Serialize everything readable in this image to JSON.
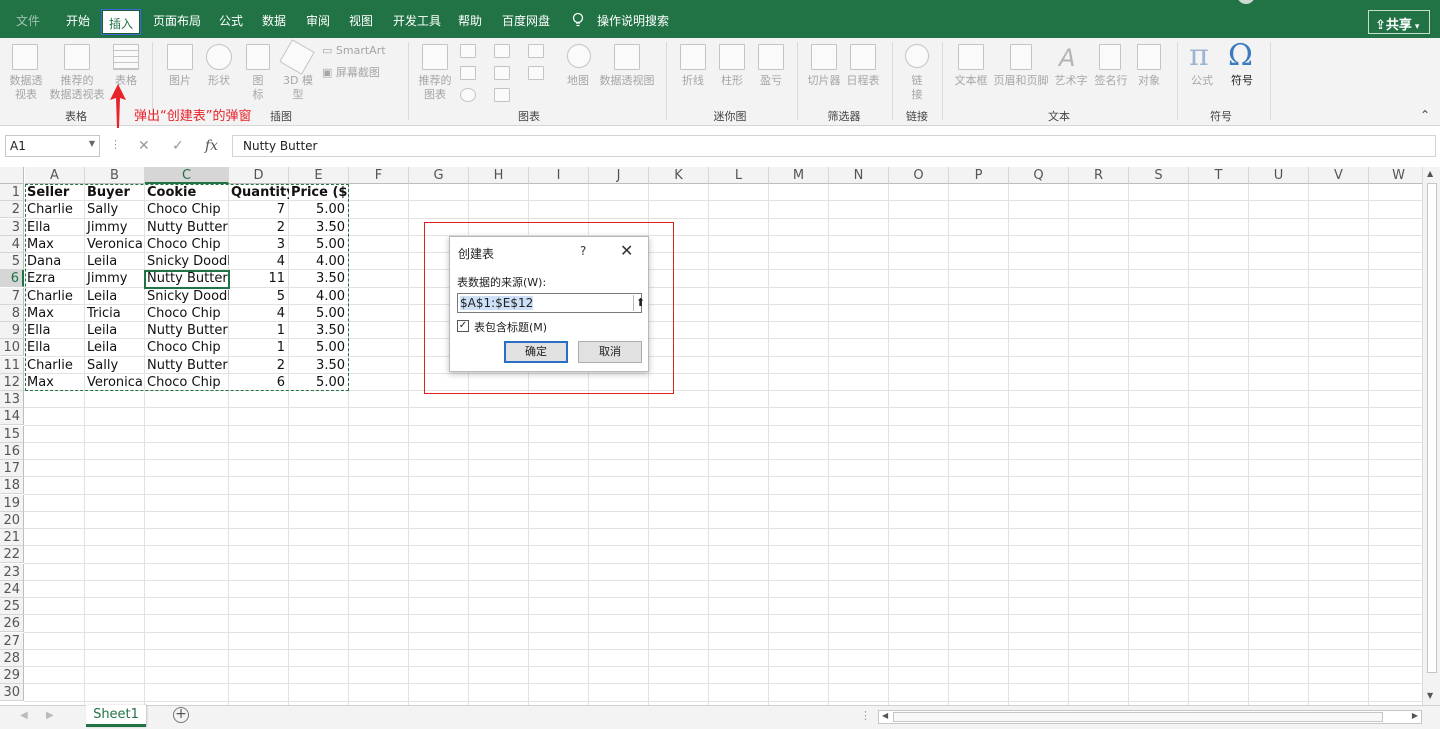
{
  "tabs": {
    "file": "文件",
    "home": "开始",
    "insert": "插入",
    "layout": "页面布局",
    "formulas": "公式",
    "data": "数据",
    "review": "审阅",
    "view": "视图",
    "developer": "开发工具",
    "help": "帮助",
    "baidu": "百度网盘",
    "tellme": "操作说明搜索",
    "share": "共享"
  },
  "ribbon": {
    "pivot": "数据透\n视表",
    "rec_pivot": "推荐的\n数据透视表",
    "table": "表格",
    "pictures": "图片",
    "shapes": "形状",
    "icons": "图\n标",
    "models": "3D 模\n型",
    "smartart": "SmartArt",
    "screenshot": "屏幕截图",
    "rec_charts": "推荐的\n图表",
    "map": "地图",
    "pivot_chart": "数据透视图",
    "line": "折线",
    "column": "柱形",
    "winloss": "盈亏",
    "slicer": "切片器",
    "timeline": "日程表",
    "link": "链\n接",
    "textbox": "文本框",
    "header_footer": "页眉和页脚",
    "wordart": "艺术字",
    "signature": "签名行",
    "object": "对象",
    "equation": "公式",
    "symbol": "符号",
    "groups": {
      "tables": "表格",
      "illustrations": "插图",
      "charts": "图表",
      "sparklines": "迷你图",
      "filters": "筛选器",
      "links": "链接",
      "text": "文本",
      "symbols": "符号"
    }
  },
  "annotation": "弹出“创建表”的弹窗",
  "formula_bar": {
    "name_box": "A1",
    "fx": "fx",
    "content": "Nutty Butter"
  },
  "columns": [
    "A",
    "B",
    "C",
    "D",
    "E",
    "F",
    "G",
    "H",
    "I",
    "J",
    "K",
    "L",
    "M",
    "N",
    "O",
    "P",
    "Q",
    "R",
    "S",
    "T",
    "U",
    "V",
    "W"
  ],
  "rows": [
    "1",
    "2",
    "3",
    "4",
    "5",
    "6",
    "7",
    "8",
    "9",
    "10",
    "11",
    "12",
    "13",
    "14",
    "15",
    "16",
    "17",
    "18",
    "19",
    "20",
    "21",
    "22",
    "23",
    "24",
    "25",
    "26",
    "27",
    "28",
    "29",
    "30"
  ],
  "headers": [
    "Seller",
    "Buyer",
    "Cookie",
    "Quantity",
    "Price ($)"
  ],
  "data": [
    [
      "Charlie",
      "Sally",
      "Choco Chip",
      "7",
      "5.00"
    ],
    [
      "Ella",
      "Jimmy",
      "Nutty Butter",
      "2",
      "3.50"
    ],
    [
      "Max",
      "Veronica",
      "Choco Chip",
      "3",
      "5.00"
    ],
    [
      "Dana",
      "Leila",
      "Snicky Doodle",
      "4",
      "4.00"
    ],
    [
      "Ezra",
      "Jimmy",
      "Nutty Butter",
      "11",
      "3.50"
    ],
    [
      "Charlie",
      "Leila",
      "Snicky Doodle",
      "5",
      "4.00"
    ],
    [
      "Max",
      "Tricia",
      "Choco Chip",
      "4",
      "5.00"
    ],
    [
      "Ella",
      "Leila",
      "Nutty Butter",
      "1",
      "3.50"
    ],
    [
      "Ella",
      "Leila",
      "Choco Chip",
      "1",
      "5.00"
    ],
    [
      "Charlie",
      "Sally",
      "Nutty Butter",
      "2",
      "3.50"
    ],
    [
      "Max",
      "Veronica",
      "Choco Chip",
      "6",
      "5.00"
    ]
  ],
  "dialog": {
    "title": "创建表",
    "help": "?",
    "close": "✕",
    "source_label": "表数据的来源(W):",
    "source_value": "$A$1:$E$12",
    "has_headers_label": "表包含标题(M)",
    "has_headers_checked": "✓",
    "ok": "确定",
    "cancel": "取消"
  },
  "sheet_tab": "Sheet1",
  "add_sheet": "+",
  "colors": {
    "accent": "#217346",
    "annotation": "#e8232a"
  }
}
